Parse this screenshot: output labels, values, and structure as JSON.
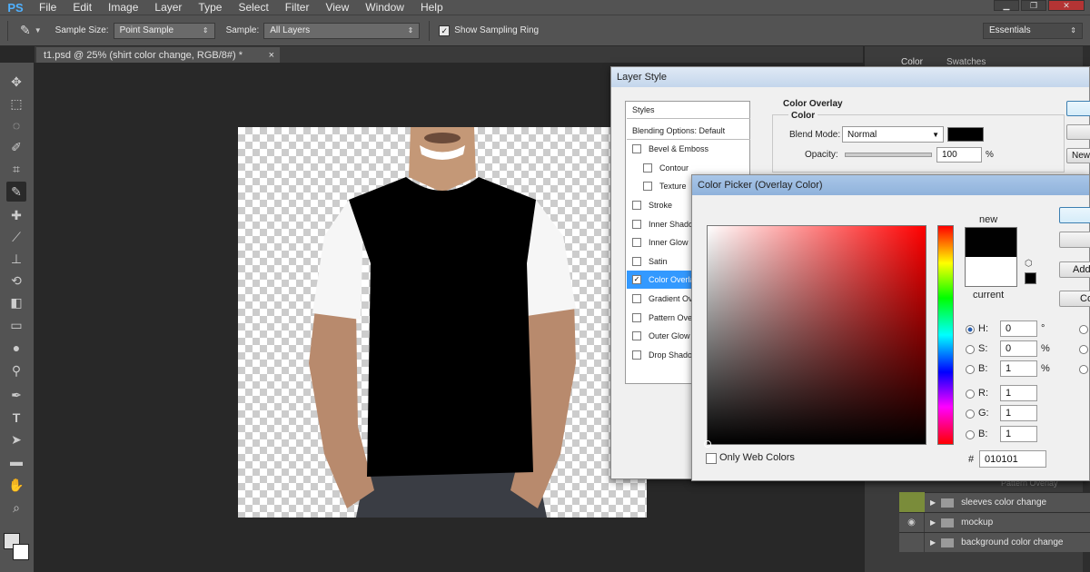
{
  "app": {
    "logo": "PS",
    "menu": [
      "File",
      "Edit",
      "Image",
      "Layer",
      "Type",
      "Select",
      "Filter",
      "View",
      "Window",
      "Help"
    ]
  },
  "options": {
    "sample_size_label": "Sample Size:",
    "sample_size_value": "Point Sample",
    "sample_label": "Sample:",
    "sample_value": "All Layers",
    "show_ring_label": "Show Sampling Ring",
    "workspace": "Essentials"
  },
  "document": {
    "tab_title": "t1.psd @ 25% (shirt  color change, RGB/8#) *",
    "tab_close": "×"
  },
  "panels": {
    "color_tab": "Color",
    "swatches_tab": "Swatches",
    "pattern_overlay_row": "Pattern Overlay"
  },
  "layers": [
    {
      "name": "sleeves  color change",
      "visible": true
    },
    {
      "name": "mockup",
      "visible": true
    },
    {
      "name": "background color change",
      "visible": false
    }
  ],
  "layer_style": {
    "title": "Layer Style",
    "styles_header": "Styles",
    "blending": "Blending Options: Default",
    "items": [
      {
        "label": "Bevel & Emboss",
        "checked": false,
        "indent": false
      },
      {
        "label": "Contour",
        "checked": false,
        "indent": true
      },
      {
        "label": "Texture",
        "checked": false,
        "indent": true
      },
      {
        "label": "Stroke",
        "checked": false,
        "indent": false
      },
      {
        "label": "Inner Shadow",
        "checked": false,
        "indent": false
      },
      {
        "label": "Inner Glow",
        "checked": false,
        "indent": false
      },
      {
        "label": "Satin",
        "checked": false,
        "indent": false
      },
      {
        "label": "Color Overlay",
        "checked": true,
        "indent": false
      },
      {
        "label": "Gradient Overlay",
        "checked": false,
        "indent": false
      },
      {
        "label": "Pattern Overlay",
        "checked": false,
        "indent": false
      },
      {
        "label": "Outer Glow",
        "checked": false,
        "indent": false
      },
      {
        "label": "Drop Shadow",
        "checked": false,
        "indent": false
      }
    ],
    "section_title": "Color Overlay",
    "group_title": "Color",
    "blend_mode_label": "Blend Mode:",
    "blend_mode_value": "Normal",
    "opacity_label": "Opacity:",
    "opacity_value": "100",
    "opacity_unit": "%",
    "overlay_color": "#000000",
    "new_btn": "New"
  },
  "color_picker": {
    "title": "Color Picker (Overlay Color)",
    "new_label": "new",
    "current_label": "current",
    "new_color": "#010101",
    "current_color": "#ffffff",
    "add_btn": "Add",
    "c_btn": "Co",
    "fields": [
      {
        "label": "H:",
        "value": "0",
        "unit": "°",
        "selected": true
      },
      {
        "label": "S:",
        "value": "0",
        "unit": "%",
        "selected": false
      },
      {
        "label": "B:",
        "value": "1",
        "unit": "%",
        "selected": false
      },
      {
        "label": "R:",
        "value": "1",
        "unit": "",
        "selected": false
      },
      {
        "label": "G:",
        "value": "1",
        "unit": "",
        "selected": false
      },
      {
        "label": "B:",
        "value": "1",
        "unit": "",
        "selected": false
      }
    ],
    "hex_label": "#",
    "hex_value": "010101",
    "web_colors_label": "Only Web Colors"
  }
}
